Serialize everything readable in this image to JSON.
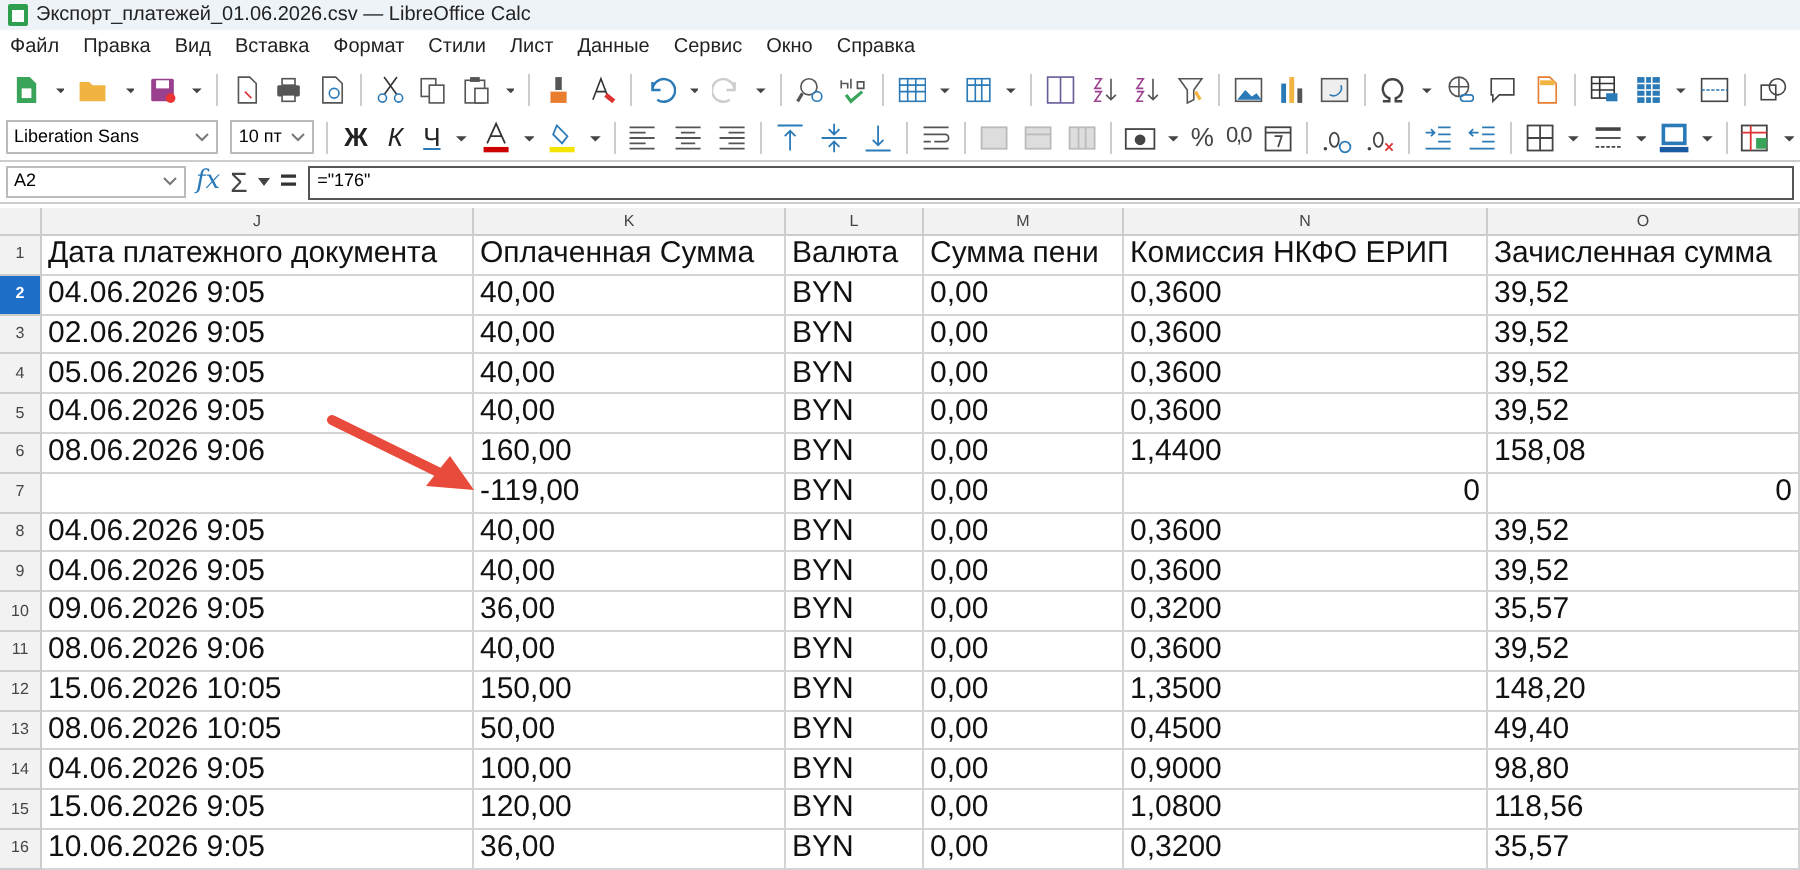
{
  "window": {
    "title": "Экспорт_платежей_01.06.2026.csv — LibreOffice Calc"
  },
  "menu": [
    "Файл",
    "Правка",
    "Вид",
    "Вставка",
    "Формат",
    "Стили",
    "Лист",
    "Данные",
    "Сервис",
    "Окно",
    "Справка"
  ],
  "format_bar": {
    "font_name": "Liberation Sans",
    "font_size": "10 пт",
    "bold": "Ж",
    "italic": "К",
    "underline": "Ч",
    "percent": "%",
    "number_format": "0,0"
  },
  "formula_bar": {
    "cell_reference": "A2",
    "function_wizard": "fx",
    "sum": "Σ",
    "equals": "=",
    "formula": "=\"176\""
  },
  "sheet": {
    "columns": [
      "J",
      "K",
      "L",
      "M",
      "N",
      "O"
    ],
    "rows": [
      {
        "number": "1",
        "selected": false,
        "cells": [
          "Дата платежного документа",
          "Оплаченная Сумма",
          "Валюта",
          "Сумма пени",
          "Комиссия НКФО ЕРИП",
          "Зачисленная сумма"
        ]
      },
      {
        "number": "2",
        "selected": true,
        "cells": [
          "04.06.2026 9:05",
          "40,00",
          "BYN",
          "0,00",
          "0,3600",
          "39,52"
        ]
      },
      {
        "number": "3",
        "selected": false,
        "cells": [
          "02.06.2026 9:05",
          "40,00",
          "BYN",
          "0,00",
          "0,3600",
          "39,52"
        ]
      },
      {
        "number": "4",
        "selected": false,
        "cells": [
          "05.06.2026 9:05",
          "40,00",
          "BYN",
          "0,00",
          "0,3600",
          "39,52"
        ]
      },
      {
        "number": "5",
        "selected": false,
        "cells": [
          "04.06.2026 9:05",
          "40,00",
          "BYN",
          "0,00",
          "0,3600",
          "39,52"
        ]
      },
      {
        "number": "6",
        "selected": false,
        "cells": [
          "08.06.2026 9:06",
          "160,00",
          "BYN",
          "0,00",
          "1,4400",
          "158,08"
        ]
      },
      {
        "number": "7",
        "selected": false,
        "cells": [
          "",
          "-119,00",
          "BYN",
          "0,00",
          {
            "text": "0",
            "kind": "number"
          },
          {
            "text": "0",
            "kind": "number"
          }
        ]
      },
      {
        "number": "8",
        "selected": false,
        "cells": [
          "04.06.2026 9:05",
          "40,00",
          "BYN",
          "0,00",
          "0,3600",
          "39,52"
        ]
      },
      {
        "number": "9",
        "selected": false,
        "cells": [
          "04.06.2026 9:05",
          "40,00",
          "BYN",
          "0,00",
          "0,3600",
          "39,52"
        ]
      },
      {
        "number": "10",
        "selected": false,
        "cells": [
          "09.06.2026 9:05",
          "36,00",
          "BYN",
          "0,00",
          "0,3200",
          "35,57"
        ]
      },
      {
        "number": "11",
        "selected": false,
        "cells": [
          "08.06.2026 9:06",
          "40,00",
          "BYN",
          "0,00",
          "0,3600",
          "39,52"
        ]
      },
      {
        "number": "12",
        "selected": false,
        "cells": [
          "15.06.2026 10:05",
          "150,00",
          "BYN",
          "0,00",
          "1,3500",
          "148,20"
        ]
      },
      {
        "number": "13",
        "selected": false,
        "cells": [
          "08.06.2026 10:05",
          "50,00",
          "BYN",
          "0,00",
          "0,4500",
          "49,40"
        ]
      },
      {
        "number": "14",
        "selected": false,
        "cells": [
          "04.06.2026 9:05",
          "100,00",
          "BYN",
          "0,00",
          "0,9000",
          "98,80"
        ]
      },
      {
        "number": "15",
        "selected": false,
        "cells": [
          "15.06.2026 9:05",
          "120,00",
          "BYN",
          "0,00",
          "1,0800",
          "118,56"
        ]
      },
      {
        "number": "16",
        "selected": false,
        "cells": [
          "10.06.2026 9:05",
          "36,00",
          "BYN",
          "0,00",
          "0,3200",
          "35,57"
        ]
      }
    ]
  }
}
